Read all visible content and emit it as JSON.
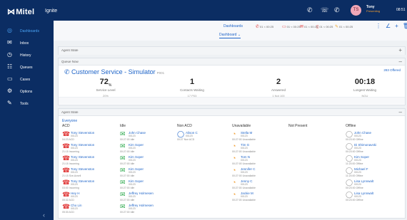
{
  "topbar": {
    "logo_mark": "⋈",
    "logo_text": "Mitel",
    "app_name": "Ignite",
    "icons": [
      "phone-forward-icon",
      "voicemail-icon",
      "phone-icon"
    ],
    "avatar_initials": "TS",
    "user_name": "Tony",
    "user_status": "Presenting",
    "clock": "08:51"
  },
  "sidebar": {
    "items": [
      {
        "label": "Dashboards",
        "icon": "◎",
        "icon_name": "dashboard-icon",
        "active": true
      },
      {
        "label": "Inbox",
        "icon": "✉",
        "icon_name": "inbox-icon",
        "active": false
      },
      {
        "label": "History",
        "icon": "◷",
        "icon_name": "history-icon",
        "active": false
      },
      {
        "label": "Queues",
        "icon": "☷",
        "icon_name": "queues-icon",
        "active": false
      },
      {
        "label": "Cases",
        "icon": "▭",
        "icon_name": "cases-icon",
        "active": false
      },
      {
        "label": "Options",
        "icon": "⚙",
        "icon_name": "options-icon",
        "active": false
      },
      {
        "label": "Tools",
        "icon": "✎",
        "icon_name": "tools-icon",
        "active": false
      }
    ],
    "collapse": "‹"
  },
  "dash": {
    "tab": "Dashboards",
    "dropdown": "Dashboard ⌄",
    "stats": [
      {
        "icon": "✆",
        "text": "01 < 00:25",
        "color": "#e03a3a"
      },
      {
        "icon": "▭",
        "text": "01 < 00:25",
        "color": "#e03a3a"
      },
      {
        "icon": "✉",
        "text": "01 < 00:25",
        "color": "#e03a3a"
      },
      {
        "icon": "▯",
        "text": "01 < 00:25",
        "color": "#e03a3a"
      },
      {
        "icon": "✎",
        "text": "01 < 00:25",
        "color": "#f1a82e"
      }
    ],
    "actions": [
      "⋮",
      "∠",
      "+",
      "🗑"
    ]
  },
  "agent_state_panel": {
    "title": "Agent State",
    "action": "+"
  },
  "queue_now_panel": {
    "title": "Queue Now",
    "action": "–",
    "queue_name": "Customer Service - Simulator",
    "queue_tail": "P001",
    "link": "283 Offered",
    "kpis": [
      {
        "value": "72",
        "unit": "%",
        "label": "Service Level",
        "sub": "20%"
      },
      {
        "value": "1",
        "unit": "",
        "label": "Contacts Waiting",
        "sub": "17 P03"
      },
      {
        "value": "2",
        "unit": "",
        "label": "Answered",
        "sub": "1 Not 100"
      },
      {
        "value": "00:18",
        "unit": "",
        "label": "Longest Waiting",
        "sub": "NGU"
      }
    ]
  },
  "agent_state_board": {
    "title": "Agent State",
    "action": "–",
    "group": "Everyone",
    "columns": [
      "ACD",
      "Idle",
      "Non ACD",
      "Unavailable",
      "Not Present",
      "Offline"
    ],
    "agents": {
      "acd": [
        {
          "name": "Tony Stevenston",
          "ext": "00123",
          "sub": "04:23 ACD",
          "icon": "red"
        },
        {
          "name": "Tony Stevenston",
          "ext": "00123",
          "sub": "21:15 Incoming",
          "icon": "red"
        },
        {
          "name": "Tony Stevenston",
          "ext": "00123",
          "sub": "21:15 Incoming",
          "icon": "red"
        },
        {
          "name": "Tony Stevenston",
          "ext": "00123",
          "sub": "21:15 Sce-Acsell",
          "icon": "red"
        },
        {
          "name": "Tony Stevenston",
          "ext": "00123",
          "sub": "03:00 Incoming",
          "icon": "red"
        },
        {
          "name": "Hey H",
          "ext": "00123",
          "sub": "05:32 ACD",
          "icon": "red"
        },
        {
          "name": "Cho Lin",
          "ext": "00123",
          "sub": "05:30 ACD",
          "icon": "red"
        }
      ],
      "idle": [
        {
          "name": "John Chase",
          "ext": "00123",
          "sub": "00:27:00 Idle",
          "icon": "green"
        },
        {
          "name": "Kim Soper",
          "ext": "00123",
          "sub": "00:27:00 Idle",
          "icon": "green"
        },
        {
          "name": "Kim Soper",
          "ext": "00123",
          "sub": "00:27:00 Idle",
          "icon": "green"
        },
        {
          "name": "Kim Soper",
          "ext": "00123",
          "sub": "00:27:00 Idle",
          "icon": "green"
        },
        {
          "name": "Kim Soper",
          "ext": "00123",
          "sub": "00:27:00 Idle",
          "icon": "green"
        },
        {
          "name": "Jeffrey Holmesen",
          "ext": "00123",
          "sub": "00:27:00 Idle",
          "icon": "green"
        },
        {
          "name": "Jeffrey Holmesen",
          "ext": "00123",
          "sub": "00:27:00 Idle",
          "icon": "green"
        }
      ],
      "non_acd": [
        {
          "name": "Alison C",
          "ext": "00123",
          "sub": "00:27 Non ACD",
          "icon": "blue"
        }
      ],
      "unavailable": [
        {
          "name": "Stella M",
          "ext": "00123",
          "sub": "00:27:00 Unavailable",
          "icon": "orange"
        },
        {
          "name": "Tim G",
          "ext": "00123",
          "sub": "00:27:00 Unavailable",
          "icon": "orange"
        },
        {
          "name": "Tom N",
          "ext": "00123",
          "sub": "00:27:00 Unavailable",
          "icon": "orange"
        },
        {
          "name": "Jennifer C",
          "ext": "00123",
          "sub": "00:27:00 Unavailable",
          "icon": "orange"
        },
        {
          "name": "Jenny C",
          "ext": "00123",
          "sub": "00:27:00 Unavailable",
          "icon": "orange"
        },
        {
          "name": "Jackie M",
          "ext": "00123",
          "sub": "00:27:00 Unavailable",
          "icon": "orange"
        }
      ],
      "offline": [
        {
          "name": "John Chase",
          "ext": "00123",
          "sub": "00:23:00 Offline",
          "icon": "grey"
        },
        {
          "name": "Di Shimonavski",
          "ext": "00123",
          "sub": "00:23:00 Offline",
          "icon": "grey"
        },
        {
          "name": "Kim Soper",
          "ext": "00123",
          "sub": "11:23:00 Offline",
          "icon": "grey"
        },
        {
          "name": "Michael F",
          "ext": "00123",
          "sub": "11:23:00 Offline",
          "icon": "grey"
        },
        {
          "name": "Lisa Lynnwalt",
          "ext": "00123",
          "sub": "00:23:00 Offline",
          "icon": "grey"
        },
        {
          "name": "Lisa Lynnwalt",
          "ext": "00123",
          "sub": "00:23:00 Offline",
          "icon": "grey"
        }
      ]
    }
  }
}
